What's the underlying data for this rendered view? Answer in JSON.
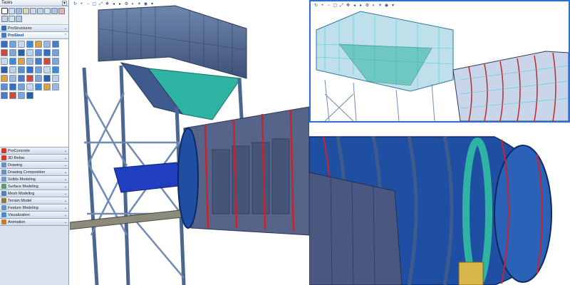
{
  "tasks_panel": {
    "title": "Tasks",
    "dropdown_glyph": "▾",
    "groups": [
      {
        "label": "ProStructures",
        "collapse": "⌄",
        "color": "#3b6bb5"
      },
      {
        "label": "ProSteel",
        "collapse": "⌃",
        "color": "#4a7ac8",
        "active": true
      },
      {
        "label": "ProConcrete",
        "collapse": "⌄",
        "color": "#c8402b"
      },
      {
        "label": "3D Rebar",
        "collapse": "⌄",
        "color": "#c8402b"
      },
      {
        "label": "Drawing",
        "collapse": "⌄",
        "color": "#6a8fc0"
      },
      {
        "label": "Drawing Composition",
        "collapse": "⌄",
        "color": "#6a8fc0"
      },
      {
        "label": "Solids Modeling",
        "collapse": "⌄",
        "color": "#7a9ac8"
      },
      {
        "label": "Surface Modeling",
        "collapse": "⌄",
        "color": "#5b9b64"
      },
      {
        "label": "Mesh Modeling",
        "collapse": "⌄",
        "color": "#5b7fb0"
      },
      {
        "label": "Terrain Model",
        "collapse": "⌄",
        "color": "#8a7a4b"
      },
      {
        "label": "Feature Modeling",
        "collapse": "⌄",
        "color": "#6a8fc0"
      },
      {
        "label": "Visualization",
        "collapse": "⌄",
        "color": "#4b8ac8"
      },
      {
        "label": "Animation",
        "collapse": "⌄",
        "color": "#c87a3b"
      }
    ]
  },
  "viewports": {
    "main_toolbar_icons": [
      "rotate-icon",
      "zoom-in-icon",
      "zoom-out-icon",
      "window-area-icon",
      "fit-view-icon",
      "pan-icon",
      "view-previous-icon",
      "view-next-icon",
      "settings-icon",
      "display-style-icon",
      "render-icon",
      "camera-icon",
      "toggle-icon"
    ],
    "top_toolbar_icons": [
      "rotate-icon",
      "zoom-in-icon",
      "zoom-out-icon",
      "window-area-icon",
      "fit-view-icon",
      "pan-icon",
      "view-previous-icon",
      "view-next-icon",
      "settings-icon",
      "display-style-icon",
      "render-icon",
      "camera-icon",
      "toggle-icon"
    ]
  },
  "colors": {
    "steel_blue": "#5b7aa8",
    "drum_blue": "#1f4fa3",
    "flange_red": "#c8242b",
    "hopper_teal": "#2fb3a3",
    "panel_slate": "#56648a",
    "wire_cyan": "#39d0e0"
  }
}
